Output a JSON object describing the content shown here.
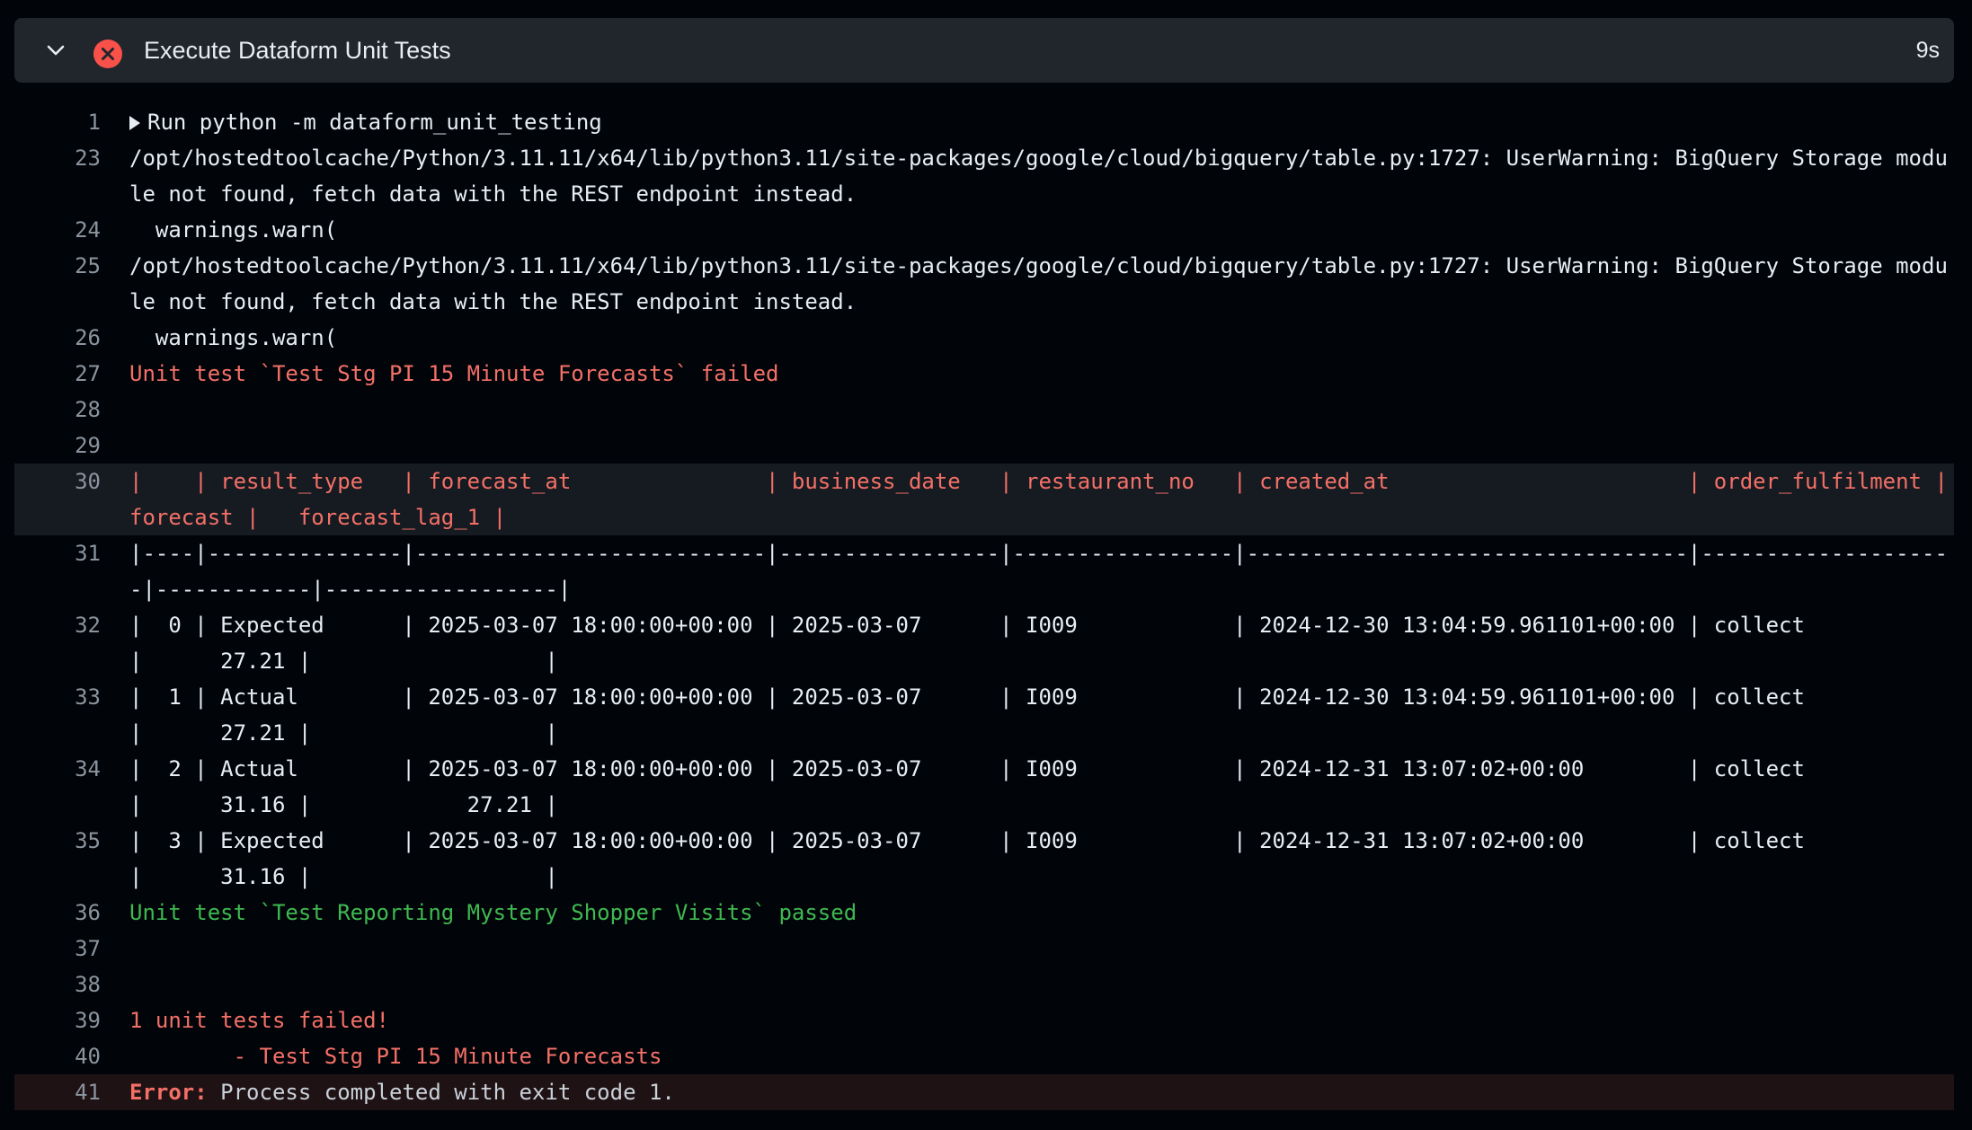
{
  "step": {
    "title": "Execute Dataform Unit Tests",
    "duration": "9s",
    "status": "failed",
    "status_color": "#f85149",
    "expand_icon": "chevron-down-icon",
    "status_icon": "x-circle-icon"
  },
  "log": {
    "lines": [
      {
        "no": "1",
        "text": "Run python -m dataform_unit_testing",
        "style": "normal",
        "expandable": true
      },
      {
        "no": "23",
        "text": "/opt/hostedtoolcache/Python/3.11.11/x64/lib/python3.11/site-packages/google/cloud/bigquery/table.py:1727: UserWarning: BigQuery Storage module not found, fetch data with the REST endpoint instead.",
        "style": "normal"
      },
      {
        "no": "24",
        "text": "  warnings.warn(",
        "style": "normal"
      },
      {
        "no": "25",
        "text": "/opt/hostedtoolcache/Python/3.11.11/x64/lib/python3.11/site-packages/google/cloud/bigquery/table.py:1727: UserWarning: BigQuery Storage module not found, fetch data with the REST endpoint instead.",
        "style": "normal"
      },
      {
        "no": "26",
        "text": "  warnings.warn(",
        "style": "normal"
      },
      {
        "no": "27",
        "text": "Unit test `Test Stg PI 15 Minute Forecasts` failed",
        "style": "red"
      },
      {
        "no": "28",
        "text": "",
        "style": "normal"
      },
      {
        "no": "29",
        "text": "",
        "style": "normal"
      },
      {
        "no": "30",
        "text": "|    | result_type   | forecast_at               | business_date   | restaurant_no   | created_at                       | order_fulfilment |   forecast |   forecast_lag_1 |",
        "style": "red",
        "highlight": true
      },
      {
        "no": "31",
        "text": "|----|---------------|---------------------------|-----------------|-----------------|----------------------------------|--------------------|------------|------------------|",
        "style": "normal"
      },
      {
        "no": "32",
        "text": "|  0 | Expected      | 2025-03-07 18:00:00+00:00 | 2025-03-07      | I009            | 2024-12-30 13:04:59.961101+00:00 | collect            |      27.21 |                  |",
        "style": "normal"
      },
      {
        "no": "33",
        "text": "|  1 | Actual        | 2025-03-07 18:00:00+00:00 | 2025-03-07      | I009            | 2024-12-30 13:04:59.961101+00:00 | collect            |      27.21 |                  |",
        "style": "normal"
      },
      {
        "no": "34",
        "text": "|  2 | Actual        | 2025-03-07 18:00:00+00:00 | 2025-03-07      | I009            | 2024-12-31 13:07:02+00:00        | collect            |      31.16 |            27.21 |",
        "style": "normal"
      },
      {
        "no": "35",
        "text": "|  3 | Expected      | 2025-03-07 18:00:00+00:00 | 2025-03-07      | I009            | 2024-12-31 13:07:02+00:00        | collect            |      31.16 |                  |",
        "style": "normal"
      },
      {
        "no": "36",
        "text": "Unit test `Test Reporting Mystery Shopper Visits` passed",
        "style": "green"
      },
      {
        "no": "37",
        "text": "",
        "style": "normal"
      },
      {
        "no": "38",
        "text": "",
        "style": "normal"
      },
      {
        "no": "39",
        "text": "1 unit tests failed!",
        "style": "red"
      },
      {
        "no": "40",
        "text": "        - Test Stg PI 15 Minute Forecasts",
        "style": "red"
      },
      {
        "no": "41",
        "prefix": "Error:",
        "text": " Process completed with exit code 1.",
        "style": "error"
      }
    ]
  }
}
